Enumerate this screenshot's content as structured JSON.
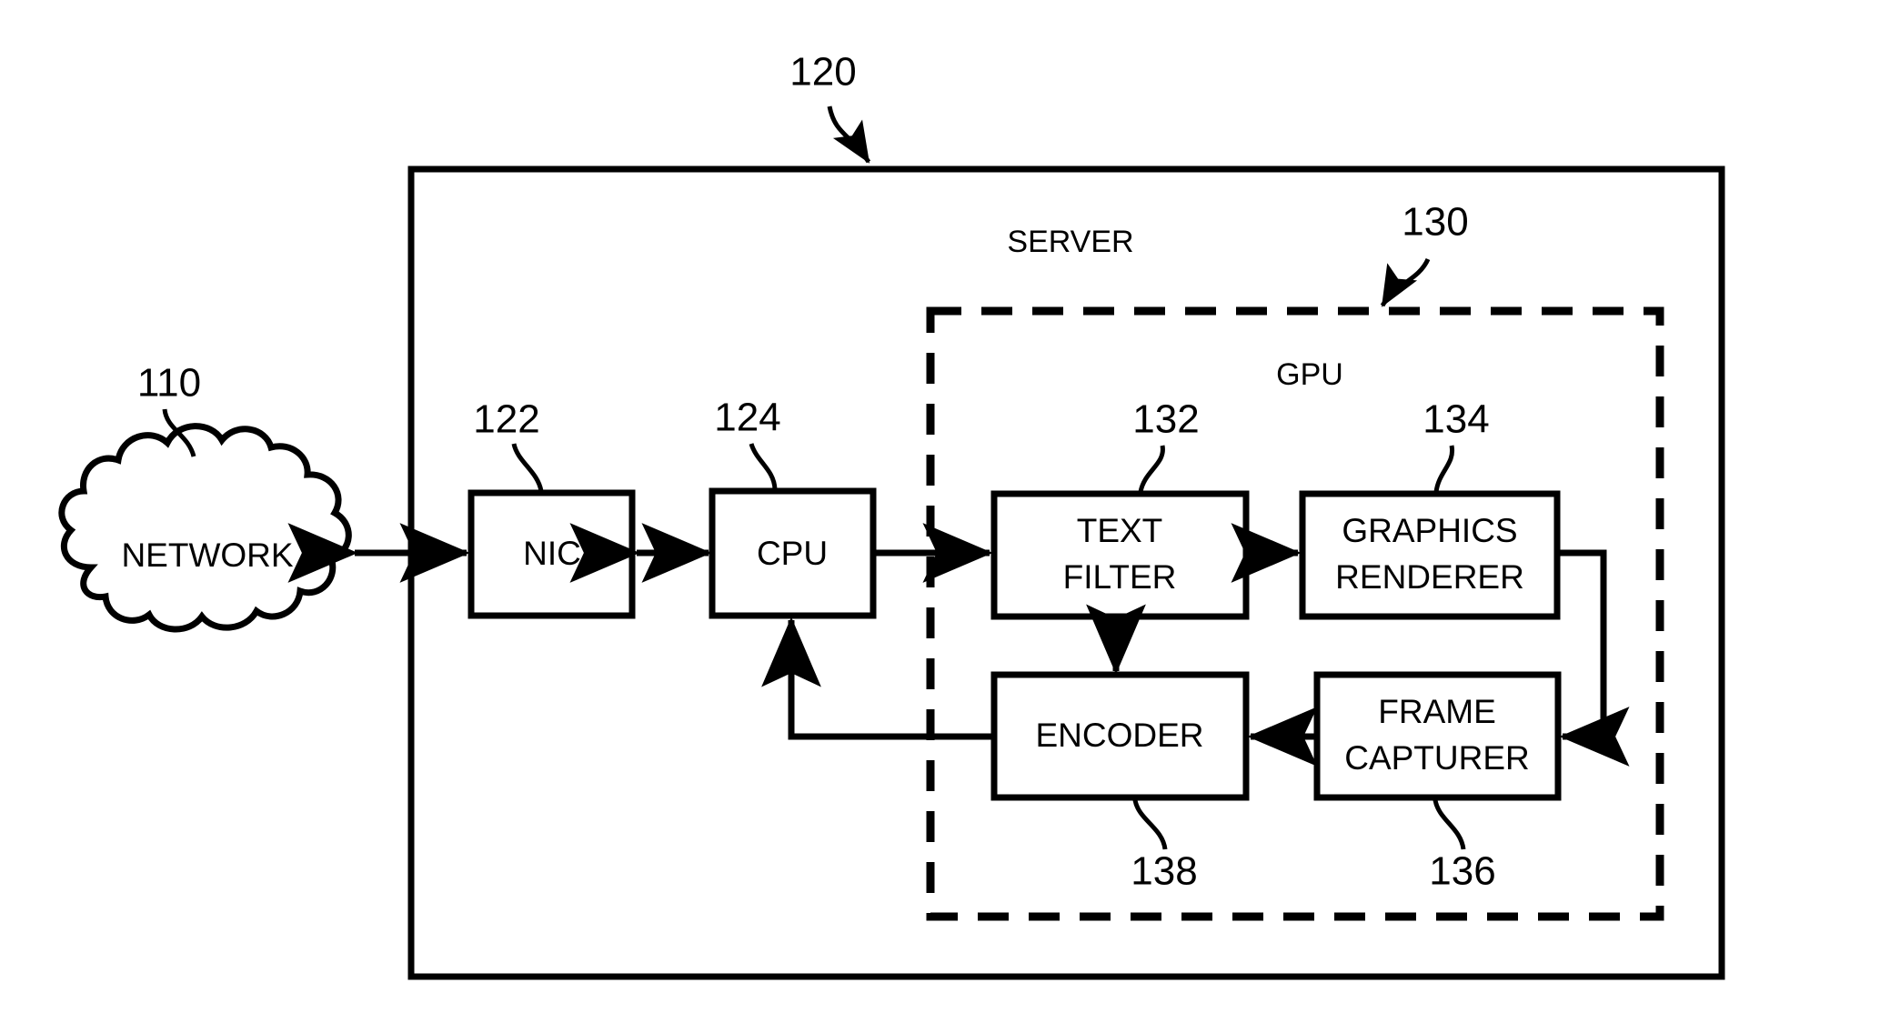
{
  "figure": {
    "type": "patent-block-diagram",
    "background_color": "#ffffff",
    "line_color": "#000000"
  },
  "nodes": {
    "network": {
      "label": "NETWORK",
      "ref": "110",
      "shape": "cloud"
    },
    "server": {
      "label": "SERVER",
      "ref": "120",
      "shape": "solid-rectangle"
    },
    "nic": {
      "label": "NIC",
      "ref": "122",
      "shape": "solid-rectangle"
    },
    "cpu": {
      "label": "CPU",
      "ref": "124",
      "shape": "solid-rectangle"
    },
    "gpu": {
      "label": "GPU",
      "ref": "130",
      "shape": "dashed-rectangle"
    },
    "text_filter": {
      "label_line1": "TEXT",
      "label_line2": "FILTER",
      "ref": "132",
      "shape": "solid-rectangle"
    },
    "graphics_renderer": {
      "label_line1": "GRAPHICS",
      "label_line2": "RENDERER",
      "ref": "134",
      "shape": "solid-rectangle"
    },
    "frame_capturer": {
      "label_line1": "FRAME",
      "label_line2": "CAPTURER",
      "ref": "136",
      "shape": "solid-rectangle"
    },
    "encoder": {
      "label": "ENCODER",
      "ref": "138",
      "shape": "solid-rectangle"
    }
  },
  "connections": [
    {
      "from": "network",
      "to": "nic",
      "style": "bidirectional"
    },
    {
      "from": "nic",
      "to": "cpu",
      "style": "bidirectional"
    },
    {
      "from": "cpu",
      "to": "text_filter",
      "style": "directed"
    },
    {
      "from": "text_filter",
      "to": "graphics_renderer",
      "style": "directed"
    },
    {
      "from": "text_filter",
      "to": "encoder",
      "style": "directed"
    },
    {
      "from": "graphics_renderer",
      "to": "frame_capturer",
      "style": "directed"
    },
    {
      "from": "frame_capturer",
      "to": "encoder",
      "style": "directed"
    },
    {
      "from": "encoder",
      "to": "cpu",
      "style": "directed"
    }
  ]
}
